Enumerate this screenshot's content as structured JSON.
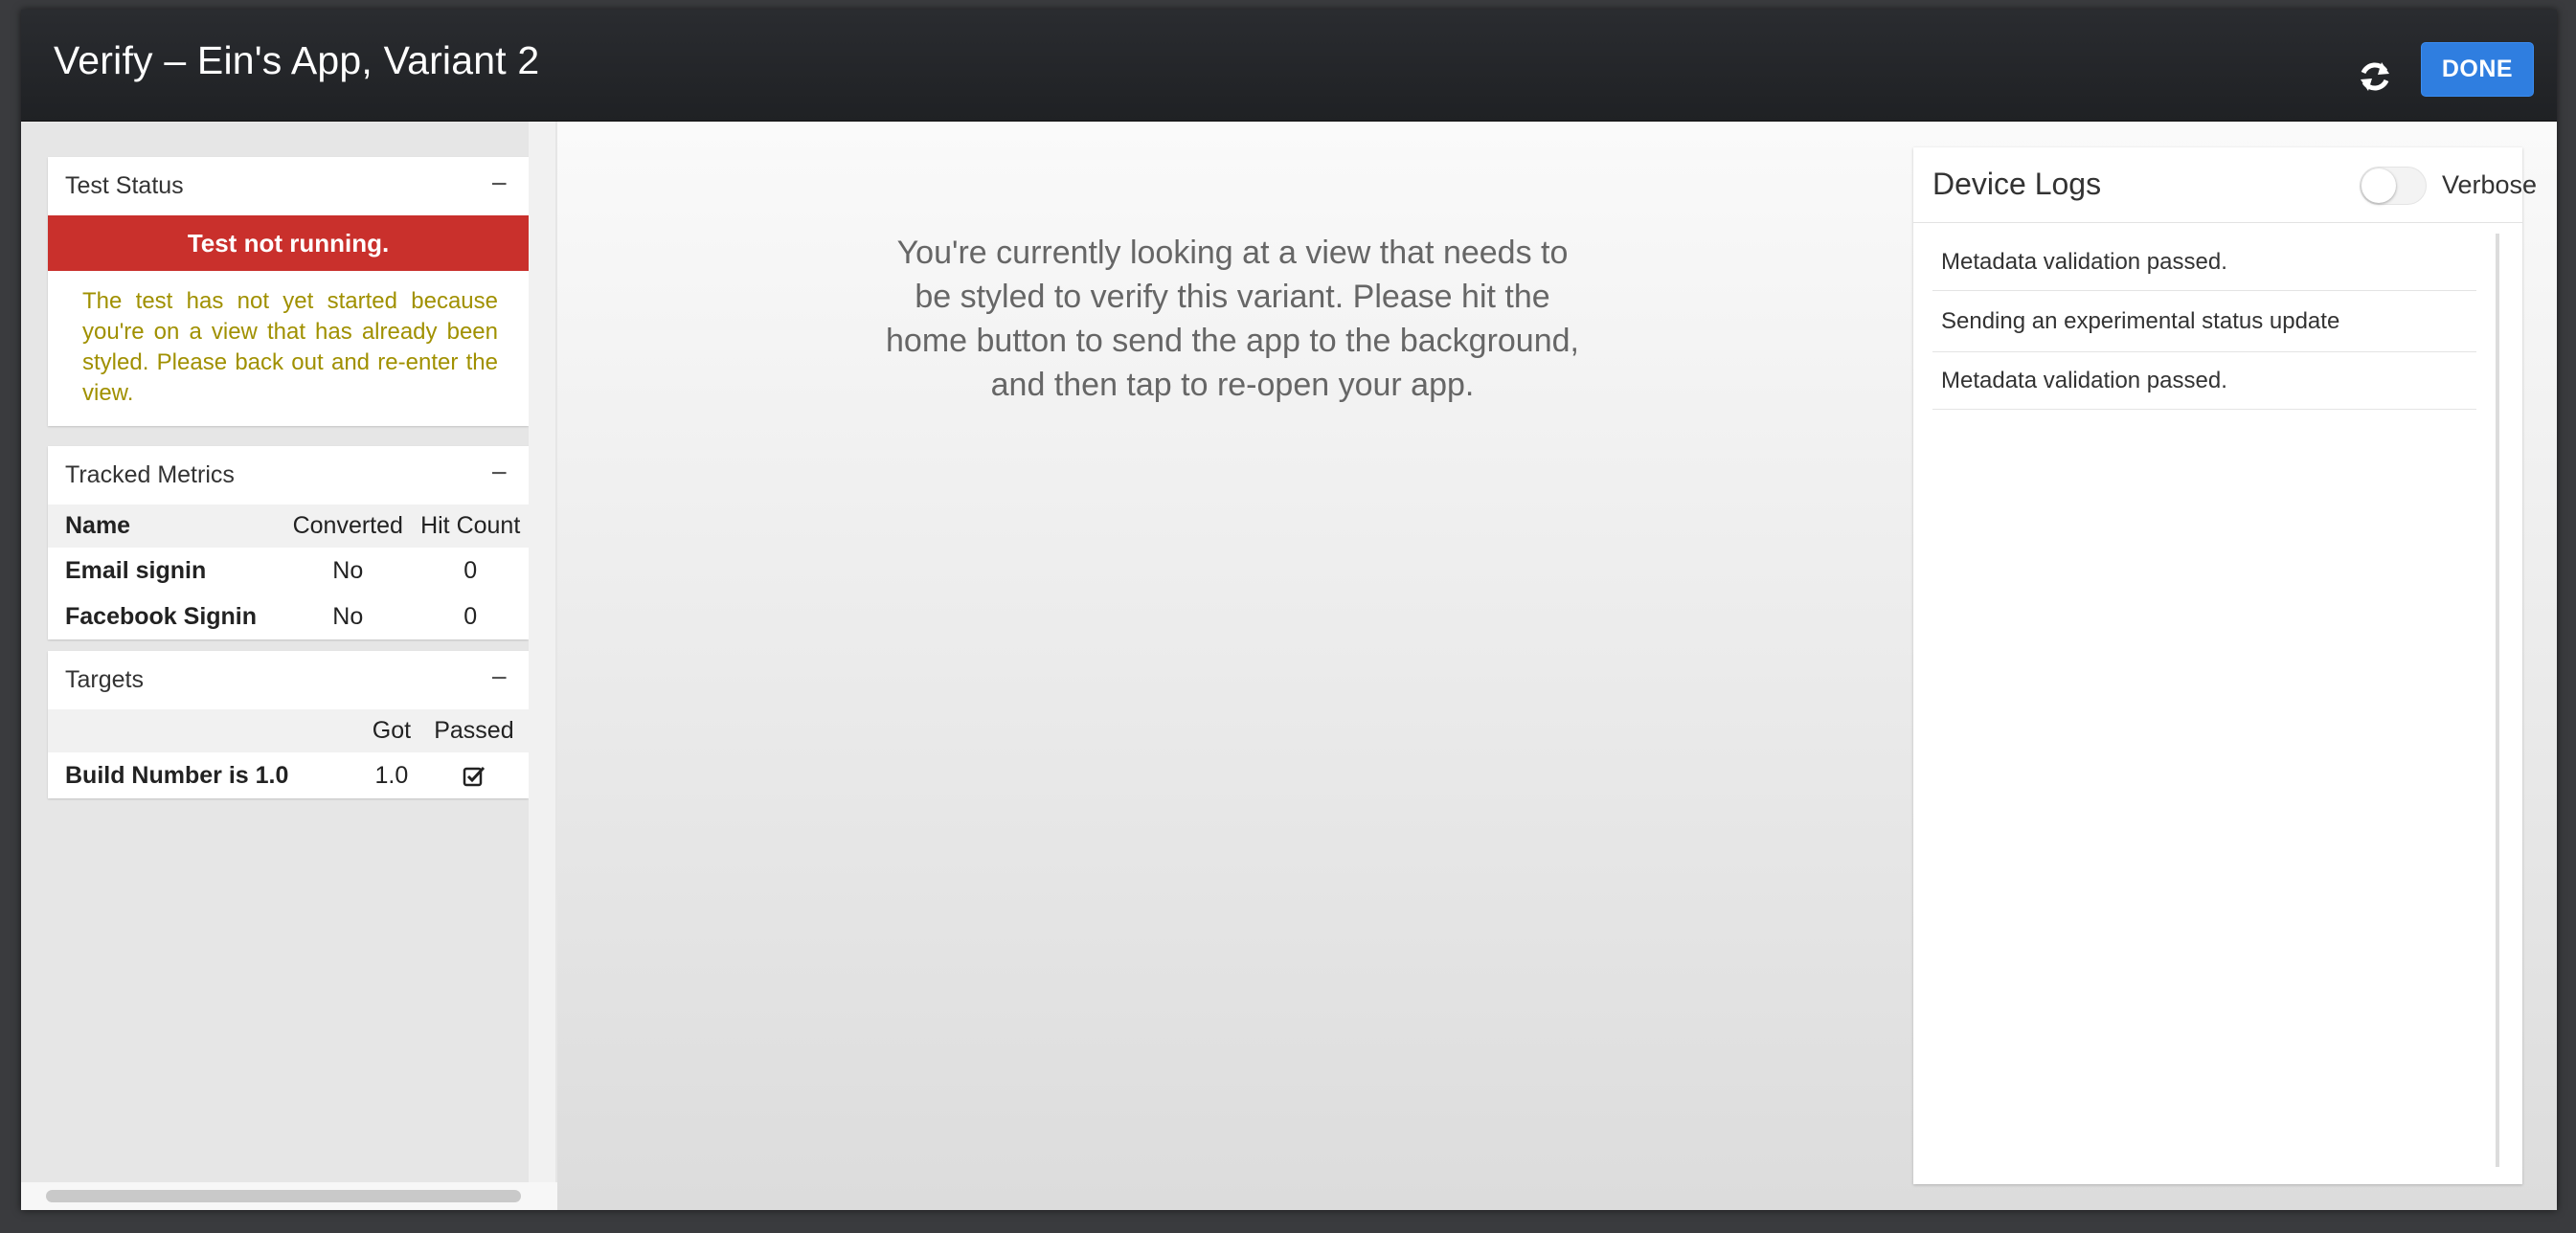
{
  "window": {
    "title": "Verify – Ein's App, Variant 2",
    "refresh_icon": "refresh-icon",
    "done_label": "DONE",
    "accent_color": "#2f7ee0"
  },
  "test_status": {
    "title": "Test Status",
    "collapse": "−",
    "status_text": "Test not running.",
    "status_color": "#c9302c",
    "message": "The test has not yet started because you're on a view that has already been styled. Please back out and re-enter the view."
  },
  "tracked_metrics": {
    "title": "Tracked Metrics",
    "collapse": "−",
    "columns": [
      "Name",
      "Converted",
      "Hit Count"
    ],
    "rows": [
      {
        "name": "Email signin",
        "converted": "No",
        "hit_count": "0"
      },
      {
        "name": "Facebook Signin",
        "converted": "No",
        "hit_count": "0"
      }
    ]
  },
  "targets": {
    "title": "Targets",
    "collapse": "−",
    "columns": [
      "",
      "Got",
      "Passed"
    ],
    "rows": [
      {
        "name": "Build Number is 1.0",
        "got": "1.0",
        "passed_icon": "checkbox-checked-icon"
      }
    ]
  },
  "main": {
    "message": "You're currently looking at a view that needs to be styled to verify this variant. Please hit the home button to send the app to the background, and then tap to re-open your app."
  },
  "device_logs": {
    "title": "Device Logs",
    "verbose_label": "Verbose",
    "verbose_on": false,
    "entries": [
      "Metadata validation passed.",
      "Sending an experimental status update",
      "Metadata validation passed."
    ]
  }
}
